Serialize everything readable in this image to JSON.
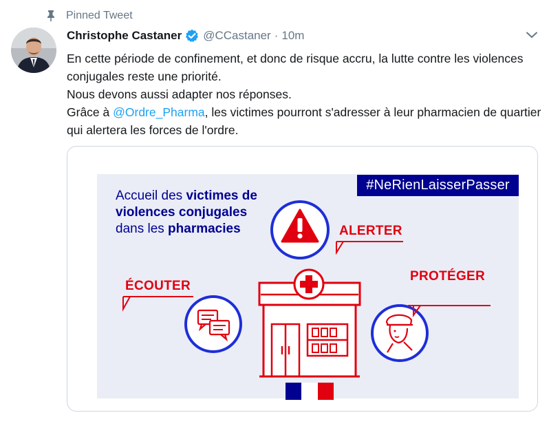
{
  "pinned": {
    "label": "Pinned Tweet"
  },
  "author": {
    "name": "Christophe Castaner",
    "handle": "@CCastaner",
    "separator": "·",
    "time": "10m"
  },
  "tweet": {
    "line1": "En cette période de confinement, et donc de risque accru, la lutte contre les violences conjugales reste une priorité.",
    "line2": "Nous devons aussi adapter nos réponses.",
    "line3_prefix": "Grâce à ",
    "mention": "@Ordre_Pharma",
    "line3_suffix": ", les victimes pourront s'adresser à leur pharmacien de quartier qui alertera les forces de l'ordre."
  },
  "poster": {
    "hashtag": "#NeRienLaisserPasser",
    "headline": {
      "p1": "Accueil des ",
      "b1": "victimes de violences conjugales",
      "p2": " dans les ",
      "b2": "pharmacies"
    },
    "labels": {
      "alerter": "ALERTER",
      "ecouter": "ÉCOUTER",
      "proteger": "PROTÉGER"
    }
  },
  "icons": {
    "pin": "pin-icon",
    "verified": "verified-badge-icon",
    "chevron": "chevron-down-icon",
    "warning": "warning-triangle-icon",
    "chat": "chat-bubbles-icon",
    "officer": "police-officer-icon",
    "pharmacy": "pharmacy-building-icon"
  },
  "colors": {
    "link": "#1da1f2",
    "verified": "#1da1f2",
    "navy": "#000091",
    "red": "#e1000f",
    "poster_bg": "#eaedf6"
  }
}
